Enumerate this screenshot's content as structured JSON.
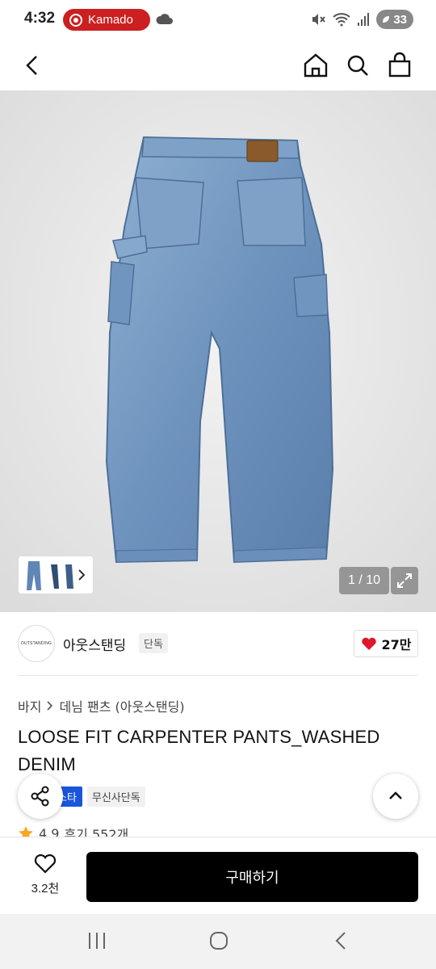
{
  "status_bar": {
    "time": "4:32",
    "recording_app": "Kamado",
    "battery": "33"
  },
  "product_image": {
    "counter": "1 / 10"
  },
  "brand": {
    "logo_text": "OUTSTANDING",
    "name": "아웃스탠딩",
    "tag": "단독",
    "likes": "27만"
  },
  "breadcrumb": [
    "바지",
    "데님 팬츠 (아웃스탠딩)"
  ],
  "product": {
    "title": "LOOSE FIT CARPENTER PANTS_WASHED DENIM",
    "badges": [
      "스타",
      "무신사단독"
    ],
    "rating": "4.9",
    "reviews": "후기 552개"
  },
  "buy_bar": {
    "wish_count": "3.2천",
    "buy_label": "구매하기"
  },
  "colors": {
    "accent_red": "#cc1f1f",
    "badge_blue": "#1a56db",
    "heart": "#e0162b"
  }
}
